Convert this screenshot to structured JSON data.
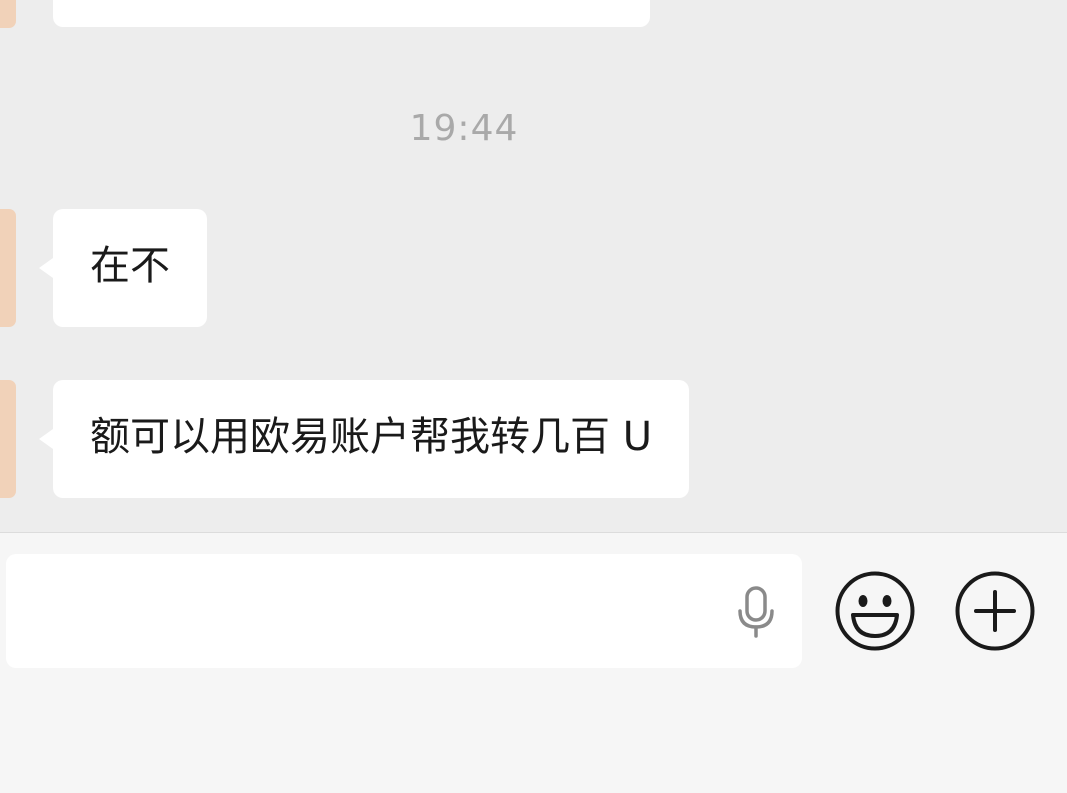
{
  "chat": {
    "timestamp": "19:44",
    "messages": [
      {
        "sender": "other",
        "text": "在不"
      },
      {
        "sender": "other",
        "text": "额可以用欧易账户帮我转几百 U"
      }
    ]
  },
  "input_bar": {
    "text_value": "",
    "icons": [
      "microphone-icon",
      "emoji-icon",
      "plus-icon"
    ]
  },
  "colors": {
    "chat_background": "#ededed",
    "bubble": "#ffffff",
    "timestamp": "#a9a9a9",
    "avatar": "#f1d2b9",
    "input_bar_background": "#f6f6f6",
    "icon_stroke": "#1a1a1a",
    "mic_icon": "#8a8a8a"
  }
}
